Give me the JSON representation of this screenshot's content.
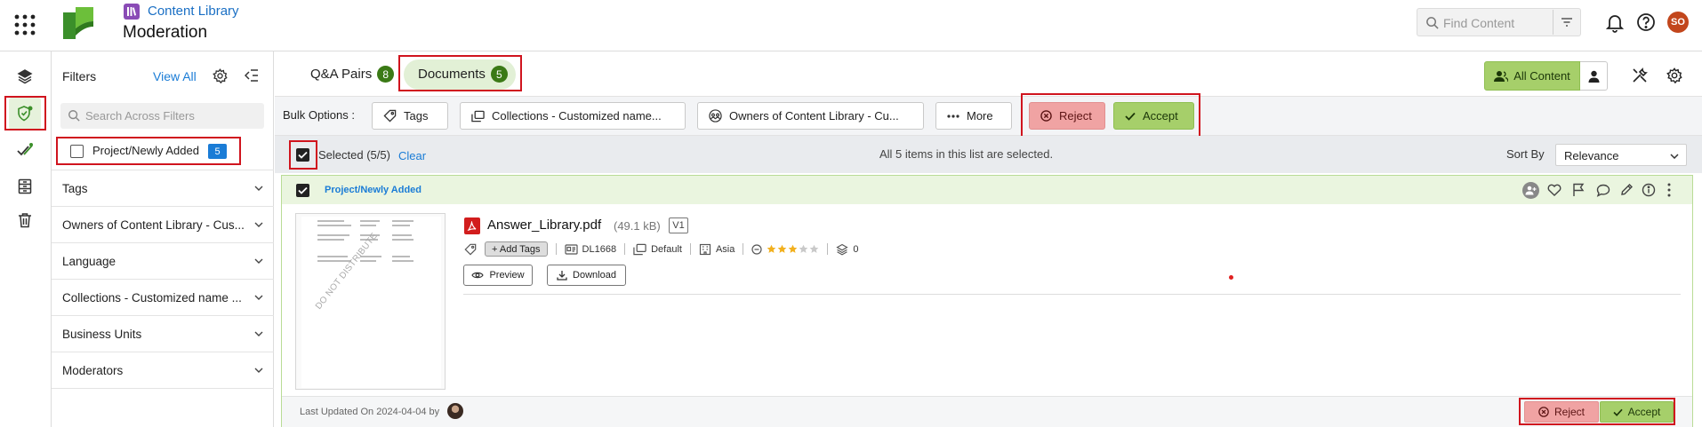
{
  "header": {
    "app_name": "Content Library",
    "page_title": "Moderation",
    "search_placeholder": "Find Content",
    "user_initials": "SO"
  },
  "filters": {
    "title": "Filters",
    "view_all": "View All",
    "search_placeholder": "Search Across Filters",
    "checkbox_label": "Project/Newly Added",
    "checkbox_count": "5",
    "sections": [
      "Tags",
      "Owners of Content Library - Cus...",
      "Language",
      "Collections - Customized name ...",
      "Business Units",
      "Moderators"
    ]
  },
  "tabs": [
    {
      "label": "Q&A Pairs",
      "count": "8"
    },
    {
      "label": "Documents",
      "count": "5"
    }
  ],
  "view_toggle": {
    "all_content": "All Content"
  },
  "bulk": {
    "label": "Bulk Options :",
    "tags": "Tags",
    "collections": "Collections - Customized name...",
    "owners": "Owners of Content Library - Cu...",
    "more": "More",
    "reject": "Reject",
    "accept": "Accept"
  },
  "selection": {
    "selected": "Selected (5/5)",
    "clear": "Clear",
    "message": "All 5 items in this list are selected.",
    "sort_label": "Sort By",
    "sort_value": "Relevance"
  },
  "group": {
    "title": "Project/Newly Added"
  },
  "document": {
    "name": "Answer_Library.pdf",
    "size": "(49.1 kB)",
    "version": "V1",
    "add_tags": "+ Add Tags",
    "id": "DL1668",
    "collection": "Default",
    "region": "Asia",
    "rating": 3,
    "rating_max": 5,
    "layers": "0",
    "preview": "Preview",
    "download": "Download",
    "watermark": "DO NOT DISTRIBUTE",
    "last_updated": "Last Updated On 2024-04-04 by",
    "reject": "Reject",
    "accept": "Accept"
  },
  "colors": {
    "brand_green": "#3b7a16",
    "accept": "#a6cf6a",
    "reject": "#f0a3a3",
    "highlight": "#d0141e",
    "link": "#1a7cd6"
  }
}
